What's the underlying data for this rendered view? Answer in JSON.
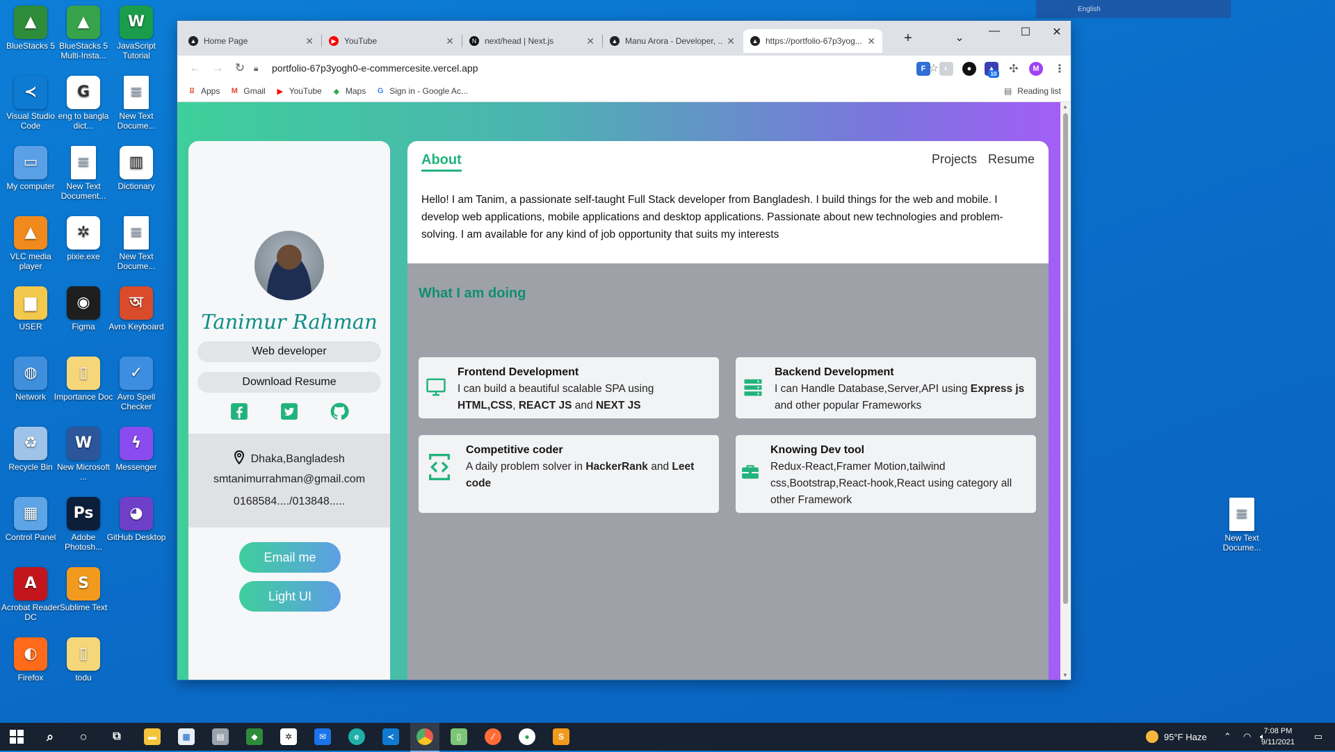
{
  "desktop": {
    "icons": [
      {
        "label": "BlueStacks 5",
        "color": "#2e8b3a",
        "glyph": "▲"
      },
      {
        "label": "BlueStacks 5 Multi-Insta...",
        "color": "#37a34a",
        "glyph": "▲"
      },
      {
        "label": "JavaScript Tutorial",
        "color": "#1a9c4a",
        "glyph": "W"
      },
      {
        "label": "Visual Studio Code",
        "color": "#0e7ad2",
        "glyph": "≺"
      },
      {
        "label": "eng to bangla dict...",
        "color": "#ffffff",
        "glyph": "G"
      },
      {
        "label": "New Text Docume...",
        "color": "doc",
        "glyph": "≡"
      },
      {
        "label": "My computer",
        "color": "#5aa0e6",
        "glyph": "▭"
      },
      {
        "label": "New Text Document...",
        "color": "doc",
        "glyph": "≡"
      },
      {
        "label": "Dictionary",
        "color": "#ffffff",
        "glyph": "▥"
      },
      {
        "label": "VLC media player",
        "color": "#f08a1c",
        "glyph": "▲"
      },
      {
        "label": "pixie.exe",
        "color": "#ffffff",
        "glyph": "✲"
      },
      {
        "label": "New Text Docume...",
        "color": "doc",
        "glyph": "≡"
      },
      {
        "label": "USER",
        "color": "#f2c94c",
        "glyph": "▆"
      },
      {
        "label": "Figma",
        "color": "#1e1e1e",
        "glyph": "◉"
      },
      {
        "label": "Avro Keyboard",
        "color": "#d94b2b",
        "glyph": "অ"
      },
      {
        "label": "Network",
        "color": "#3f8fdc",
        "glyph": "◍"
      },
      {
        "label": "Importance Doc",
        "color": "#f5d77a",
        "glyph": "▯"
      },
      {
        "label": "Avro Spell Checker",
        "color": "#3d8de0",
        "glyph": "✓"
      },
      {
        "label": "Recycle Bin",
        "color": "#9fc3e8",
        "glyph": "♻"
      },
      {
        "label": "New Microsoft ...",
        "color": "#2b579a",
        "glyph": "W"
      },
      {
        "label": "Messenger",
        "color": "#8a4cf0",
        "glyph": "ϟ"
      },
      {
        "label": "Control Panel",
        "color": "#5da5e6",
        "glyph": "▦"
      },
      {
        "label": "Adobe Photosh...",
        "color": "#0b1f3a",
        "glyph": "Ps"
      },
      {
        "label": "GitHub Desktop",
        "color": "#6e40c9",
        "glyph": "◕"
      },
      {
        "label": "Acrobat Reader DC",
        "color": "#c3161c",
        "glyph": "A"
      },
      {
        "label": "Sublime Text",
        "color": "#f29a1d",
        "glyph": "S"
      },
      {
        "label": "",
        "color": "#ffffff",
        "glyph": ""
      },
      {
        "label": "Firefox",
        "color": "#ff6b1a",
        "glyph": "◐"
      },
      {
        "label": "todu",
        "color": "#f5d77a",
        "glyph": "▯"
      }
    ],
    "right_icon": {
      "label": "New Text Docume..."
    },
    "lang_bar": "English"
  },
  "browser": {
    "tabs": [
      {
        "title": "Home Page",
        "fav_color": "#202124",
        "fav": "▲"
      },
      {
        "title": "YouTube",
        "fav_color": "#ff0000",
        "fav": "▶"
      },
      {
        "title": "next/head | Next.js",
        "fav_color": "#111111",
        "fav": "N"
      },
      {
        "title": "Manu Arora - Developer, ...",
        "fav_color": "#202124",
        "fav": "▲"
      },
      {
        "title": "https://portfolio-67p3yog...",
        "fav_color": "#202124",
        "fav": "▲"
      }
    ],
    "url": "portfolio-67p3yogh0-e-commercesite.vercel.app",
    "bookmarks": [
      {
        "label": "Apps",
        "icon_color": "#ea4335",
        "glyph": "⠿"
      },
      {
        "label": "Gmail",
        "icon_color": "#ea4335",
        "glyph": "M"
      },
      {
        "label": "YouTube",
        "icon_color": "#ff0000",
        "glyph": "▶"
      },
      {
        "label": "Maps",
        "icon_color": "#34a853",
        "glyph": "◆"
      },
      {
        "label": "Sign in - Google Ac...",
        "icon_color": "#4285f4",
        "glyph": "G"
      }
    ],
    "reading_list": "Reading list",
    "profile_initial": "M",
    "ext_badge": "10"
  },
  "profile": {
    "name": "Tanimur Rahman",
    "role": "Web developer",
    "download": "Download Resume",
    "location": "Dhaka,Bangladesh",
    "email": "smtanimurrahman@gmail.com",
    "phone": "0168584..../013848.....",
    "email_btn": "Email me",
    "theme_btn": "Light UI"
  },
  "main": {
    "nav": {
      "about": "About",
      "projects": "Projects",
      "resume": "Resume"
    },
    "about_text": "Hello! I am Tanim, a passionate self-taught Full Stack developer from Bangladesh. I build things for the web and mobile. I develop web applications, mobile applications and desktop applications. Passionate about new technologies and problem-solving. I am available for any kind of job opportunity that suits my interests",
    "doing_title": "What I am doing",
    "services": [
      {
        "title": "Frontend Development",
        "text_a": "I can build a beautiful scalable SPA using ",
        "b1": "HTML,CSS",
        "t2": ", ",
        "b2": "REACT JS",
        "t3": " and ",
        "b3": "NEXT JS",
        "t4": ""
      },
      {
        "title": "Backend Development",
        "text_a": "I can Handle Database,Server,API using ",
        "b1": "Express js",
        "t2": " and other popular Frameworks",
        "b2": "",
        "t3": "",
        "b3": "",
        "t4": ""
      },
      {
        "title": "Competitive coder",
        "text_a": "A daily problem solver in ",
        "b1": "HackerRank",
        "t2": " and ",
        "b2": "Leet code",
        "t3": "",
        "b3": "",
        "t4": ""
      },
      {
        "title": "Knowing Dev tool",
        "text_a": "Redux-React,Framer Motion,tailwind css,Bootstrap,React-hook,React using category all other Framework",
        "b1": "",
        "t2": "",
        "b2": "",
        "t3": "",
        "b3": "",
        "t4": ""
      }
    ]
  },
  "taskbar": {
    "weather": "95°F  Haze",
    "time": "7:08 PM",
    "date": "9/11/2021",
    "accent": "#17212f"
  }
}
